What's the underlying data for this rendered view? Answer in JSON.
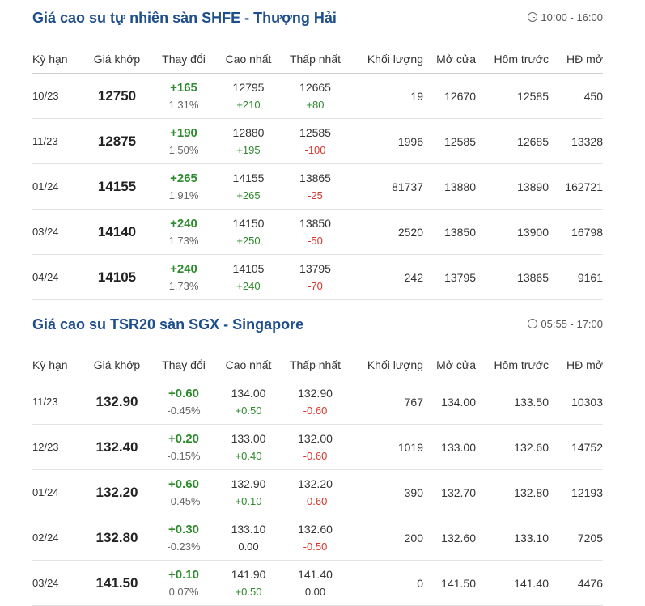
{
  "sections": [
    {
      "title": "Giá cao su tự nhiên sàn SHFE - Thượng Hải",
      "time": "10:00 - 16:00",
      "headers": [
        "Kỳ hạn",
        "Giá khớp",
        "Thay đổi",
        "Cao nhất",
        "Thấp nhất",
        "Khối lượng",
        "Mở cửa",
        "Hôm trước",
        "HĐ mở"
      ],
      "rows": [
        {
          "term": "10/23",
          "price": "12750",
          "change": "+165",
          "pct": "1.31%",
          "high": "12795",
          "high_diff": "+210",
          "low": "12665",
          "low_diff": "+80",
          "volume": "19",
          "open": "12670",
          "prev": "12585",
          "oi": "450"
        },
        {
          "term": "11/23",
          "price": "12875",
          "change": "+190",
          "pct": "1.50%",
          "high": "12880",
          "high_diff": "+195",
          "low": "12585",
          "low_diff": "-100",
          "volume": "1996",
          "open": "12585",
          "prev": "12685",
          "oi": "13328"
        },
        {
          "term": "01/24",
          "price": "14155",
          "change": "+265",
          "pct": "1.91%",
          "high": "14155",
          "high_diff": "+265",
          "low": "13865",
          "low_diff": "-25",
          "volume": "81737",
          "open": "13880",
          "prev": "13890",
          "oi": "162721"
        },
        {
          "term": "03/24",
          "price": "14140",
          "change": "+240",
          "pct": "1.73%",
          "high": "14150",
          "high_diff": "+250",
          "low": "13850",
          "low_diff": "-50",
          "volume": "2520",
          "open": "13850",
          "prev": "13900",
          "oi": "16798"
        },
        {
          "term": "04/24",
          "price": "14105",
          "change": "+240",
          "pct": "1.73%",
          "high": "14105",
          "high_diff": "+240",
          "low": "13795",
          "low_diff": "-70",
          "volume": "242",
          "open": "13795",
          "prev": "13865",
          "oi": "9161"
        }
      ]
    },
    {
      "title": "Giá cao su TSR20 sàn SGX - Singapore",
      "time": "05:55 - 17:00",
      "headers": [
        "Kỳ hạn",
        "Giá khớp",
        "Thay đổi",
        "Cao nhất",
        "Thấp nhất",
        "Khối lượng",
        "Mở cửa",
        "Hôm trước",
        "HĐ mở"
      ],
      "rows": [
        {
          "term": "11/23",
          "price": "132.90",
          "change": "+0.60",
          "pct": "-0.45%",
          "high": "134.00",
          "high_diff": "+0.50",
          "low": "132.90",
          "low_diff": "-0.60",
          "volume": "767",
          "open": "134.00",
          "prev": "133.50",
          "oi": "10303"
        },
        {
          "term": "12/23",
          "price": "132.40",
          "change": "+0.20",
          "pct": "-0.15%",
          "high": "133.00",
          "high_diff": "+0.40",
          "low": "132.00",
          "low_diff": "-0.60",
          "volume": "1019",
          "open": "133.00",
          "prev": "132.60",
          "oi": "14752"
        },
        {
          "term": "01/24",
          "price": "132.20",
          "change": "+0.60",
          "pct": "-0.45%",
          "high": "132.90",
          "high_diff": "+0.10",
          "low": "132.20",
          "low_diff": "-0.60",
          "volume": "390",
          "open": "132.70",
          "prev": "132.80",
          "oi": "12193"
        },
        {
          "term": "02/24",
          "price": "132.80",
          "change": "+0.30",
          "pct": "-0.23%",
          "high": "133.10",
          "high_diff": "0.00",
          "low": "132.60",
          "low_diff": "-0.50",
          "volume": "200",
          "open": "132.60",
          "prev": "133.10",
          "oi": "7205"
        },
        {
          "term": "03/24",
          "price": "141.50",
          "change": "+0.10",
          "pct": "0.07%",
          "high": "141.90",
          "high_diff": "+0.50",
          "low": "141.40",
          "low_diff": "0.00",
          "volume": "0",
          "open": "141.50",
          "prev": "141.40",
          "oi": "4476"
        }
      ]
    }
  ],
  "colors": {
    "title": "#1f4e8c",
    "up": "#2e8b2e",
    "down": "#d9352b"
  }
}
